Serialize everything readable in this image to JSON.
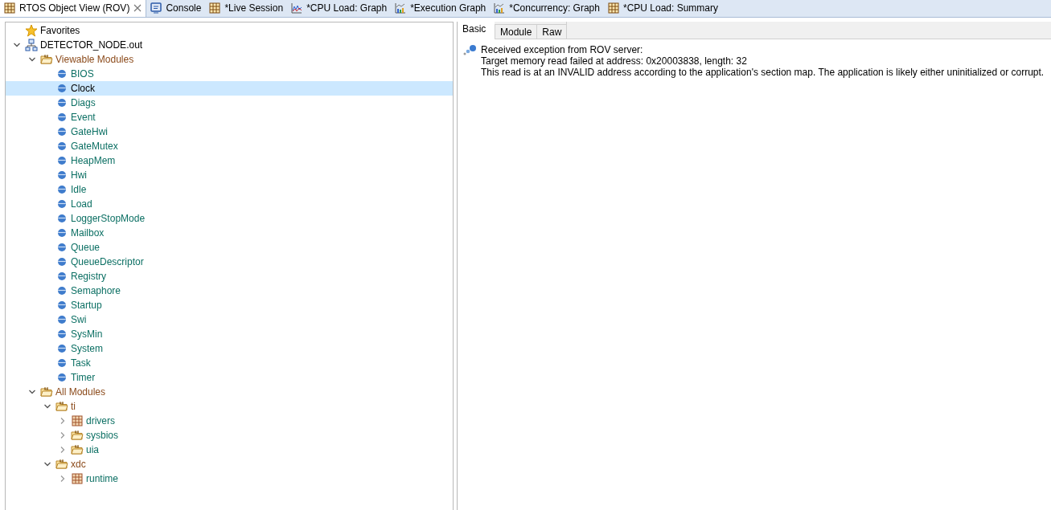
{
  "editor_tabs": [
    {
      "label": "RTOS Object View (ROV)",
      "kind": "table",
      "selected": true
    },
    {
      "label": "Console",
      "kind": "console",
      "selected": false
    },
    {
      "label": "*Live Session",
      "kind": "table",
      "selected": false
    },
    {
      "label": "*CPU Load: Graph",
      "kind": "graph",
      "selected": false
    },
    {
      "label": "*Execution Graph",
      "kind": "chart",
      "selected": false
    },
    {
      "label": "*Concurrency: Graph",
      "kind": "chart",
      "selected": false
    },
    {
      "label": "*CPU Load: Summary",
      "kind": "table",
      "selected": false
    }
  ],
  "tree": [
    {
      "label": "Favorites",
      "kind": "favorites",
      "selected": false
    },
    {
      "label": "DETECTOR_NODE.out",
      "kind": "target",
      "selected": false,
      "expanded": true,
      "children": [
        {
          "label": "Viewable Modules",
          "kind": "folder",
          "selected": false,
          "expanded": true,
          "children": [
            {
              "label": "BIOS",
              "kind": "module",
              "selected": false
            },
            {
              "label": "Clock",
              "kind": "module",
              "selected": true
            },
            {
              "label": "Diags",
              "kind": "module",
              "selected": false
            },
            {
              "label": "Event",
              "kind": "module",
              "selected": false
            },
            {
              "label": "GateHwi",
              "kind": "module",
              "selected": false
            },
            {
              "label": "GateMutex",
              "kind": "module",
              "selected": false
            },
            {
              "label": "HeapMem",
              "kind": "module",
              "selected": false
            },
            {
              "label": "Hwi",
              "kind": "module",
              "selected": false
            },
            {
              "label": "Idle",
              "kind": "module",
              "selected": false
            },
            {
              "label": "Load",
              "kind": "module",
              "selected": false
            },
            {
              "label": "LoggerStopMode",
              "kind": "module",
              "selected": false
            },
            {
              "label": "Mailbox",
              "kind": "module",
              "selected": false
            },
            {
              "label": "Queue",
              "kind": "module",
              "selected": false
            },
            {
              "label": "QueueDescriptor",
              "kind": "module",
              "selected": false
            },
            {
              "label": "Registry",
              "kind": "module",
              "selected": false
            },
            {
              "label": "Semaphore",
              "kind": "module",
              "selected": false
            },
            {
              "label": "Startup",
              "kind": "module",
              "selected": false
            },
            {
              "label": "Swi",
              "kind": "module",
              "selected": false
            },
            {
              "label": "SysMin",
              "kind": "module",
              "selected": false
            },
            {
              "label": "System",
              "kind": "module",
              "selected": false
            },
            {
              "label": "Task",
              "kind": "module",
              "selected": false
            },
            {
              "label": "Timer",
              "kind": "module",
              "selected": false
            }
          ]
        },
        {
          "label": "All Modules",
          "kind": "folder",
          "selected": false,
          "expanded": true,
          "children": [
            {
              "label": "ti",
              "kind": "folder",
              "selected": false,
              "expanded": true,
              "children": [
                {
                  "label": "drivers",
                  "kind": "package",
                  "selected": false,
                  "expanded": false
                },
                {
                  "label": "sysbios",
                  "kind": "subfolder",
                  "selected": false,
                  "expanded": false
                },
                {
                  "label": "uia",
                  "kind": "subfolder",
                  "selected": false,
                  "expanded": false
                }
              ]
            },
            {
              "label": "xdc",
              "kind": "folder",
              "selected": false,
              "expanded": true,
              "children": [
                {
                  "label": "runtime",
                  "kind": "package",
                  "selected": false,
                  "expanded": false
                }
              ]
            }
          ]
        }
      ]
    }
  ],
  "detail_tabs": [
    {
      "label": "Basic",
      "selected": true
    },
    {
      "label": "Module",
      "selected": false
    },
    {
      "label": "Raw",
      "selected": false
    }
  ],
  "message": {
    "title": "Received exception from ROV server:",
    "lines": [
      "Target memory read failed at address: 0x20003838, length: 32",
      "This read is at an INVALID address according to the application's section map. The application is likely either uninitialized or corrupt."
    ]
  }
}
